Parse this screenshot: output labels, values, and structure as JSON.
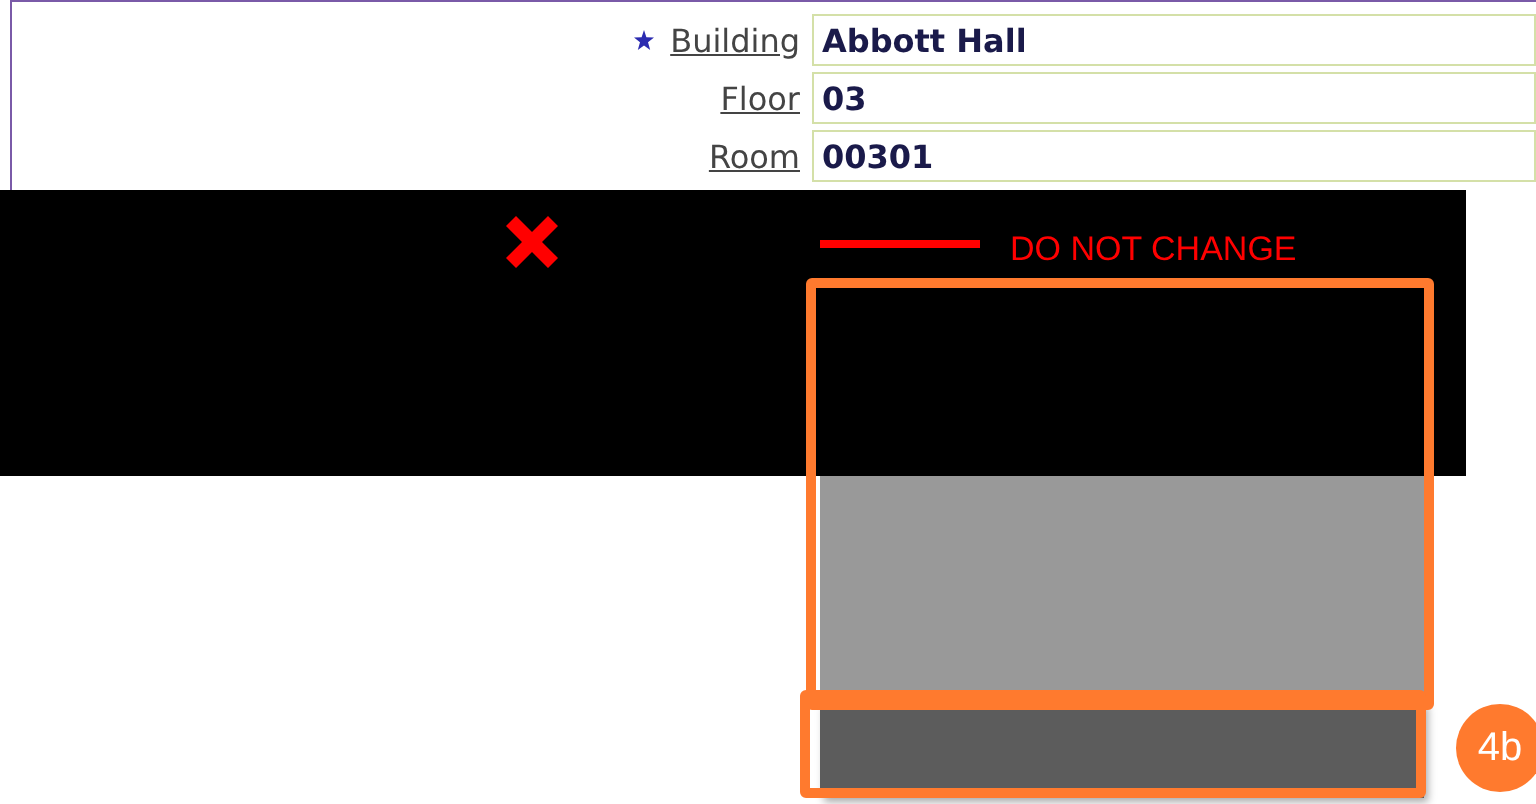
{
  "form": {
    "fields": [
      {
        "label": "Building",
        "value": "Abbott Hall",
        "required": true
      },
      {
        "label": "Floor",
        "value": "03",
        "required": false
      },
      {
        "label": "Room",
        "value": "00301",
        "required": false
      }
    ]
  },
  "annotations": {
    "warning": "DO NOT CHANGE",
    "step_badge": "4b"
  }
}
